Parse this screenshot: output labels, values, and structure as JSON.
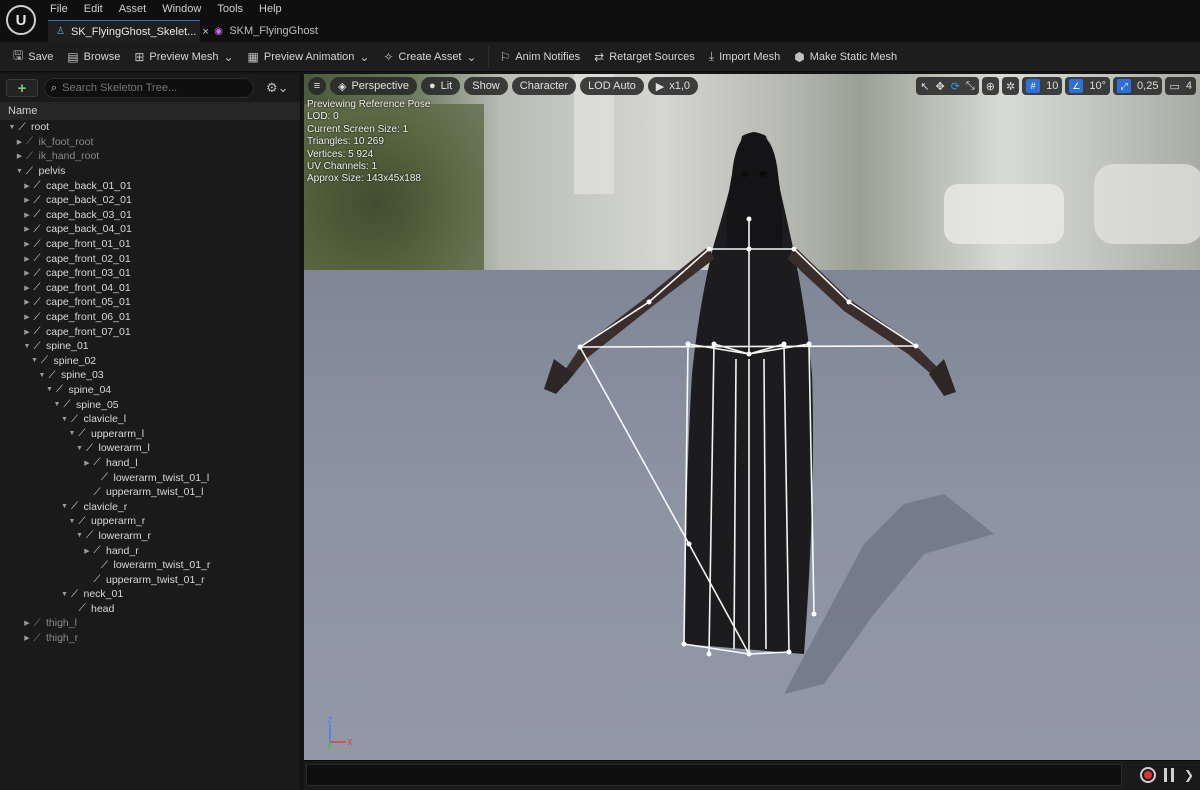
{
  "menu": [
    "File",
    "Edit",
    "Asset",
    "Window",
    "Tools",
    "Help"
  ],
  "tabs": [
    {
      "label": "SK_FlyingGhost_Skelet...",
      "close": "×"
    },
    {
      "label": "SKM_FlyingGhost"
    }
  ],
  "toolbar": {
    "save": "Save",
    "browse": "Browse",
    "preview_mesh": "Preview Mesh",
    "preview_animation": "Preview Animation",
    "create_asset": "Create Asset",
    "anim_notifies": "Anim Notifies",
    "retarget_sources": "Retarget Sources",
    "import_mesh": "Import Mesh",
    "make_static_mesh": "Make Static Mesh"
  },
  "skeleton_tree": {
    "search_placeholder": "Search Skeleton Tree...",
    "column_name": "Name",
    "bones": [
      {
        "name": "root",
        "depth": 0,
        "arrow": "open",
        "dim": false
      },
      {
        "name": "ik_foot_root",
        "depth": 1,
        "arrow": "closed",
        "dim": true
      },
      {
        "name": "ik_hand_root",
        "depth": 1,
        "arrow": "closed",
        "dim": true
      },
      {
        "name": "pelvis",
        "depth": 1,
        "arrow": "open",
        "dim": false
      },
      {
        "name": "cape_back_01_01",
        "depth": 2,
        "arrow": "closed",
        "dim": false
      },
      {
        "name": "cape_back_02_01",
        "depth": 2,
        "arrow": "closed",
        "dim": false
      },
      {
        "name": "cape_back_03_01",
        "depth": 2,
        "arrow": "closed",
        "dim": false
      },
      {
        "name": "cape_back_04_01",
        "depth": 2,
        "arrow": "closed",
        "dim": false
      },
      {
        "name": "cape_front_01_01",
        "depth": 2,
        "arrow": "closed",
        "dim": false
      },
      {
        "name": "cape_front_02_01",
        "depth": 2,
        "arrow": "closed",
        "dim": false
      },
      {
        "name": "cape_front_03_01",
        "depth": 2,
        "arrow": "closed",
        "dim": false
      },
      {
        "name": "cape_front_04_01",
        "depth": 2,
        "arrow": "closed",
        "dim": false
      },
      {
        "name": "cape_front_05_01",
        "depth": 2,
        "arrow": "closed",
        "dim": false
      },
      {
        "name": "cape_front_06_01",
        "depth": 2,
        "arrow": "closed",
        "dim": false
      },
      {
        "name": "cape_front_07_01",
        "depth": 2,
        "arrow": "closed",
        "dim": false
      },
      {
        "name": "spine_01",
        "depth": 2,
        "arrow": "open",
        "dim": false
      },
      {
        "name": "spine_02",
        "depth": 3,
        "arrow": "open",
        "dim": false
      },
      {
        "name": "spine_03",
        "depth": 4,
        "arrow": "open",
        "dim": false
      },
      {
        "name": "spine_04",
        "depth": 5,
        "arrow": "open",
        "dim": false
      },
      {
        "name": "spine_05",
        "depth": 6,
        "arrow": "open",
        "dim": false
      },
      {
        "name": "clavicle_l",
        "depth": 7,
        "arrow": "open",
        "dim": false
      },
      {
        "name": "upperarm_l",
        "depth": 8,
        "arrow": "open",
        "dim": false
      },
      {
        "name": "lowerarm_l",
        "depth": 9,
        "arrow": "open",
        "dim": false
      },
      {
        "name": "hand_l",
        "depth": 10,
        "arrow": "closed",
        "dim": false
      },
      {
        "name": "lowerarm_twist_01_l",
        "depth": 11,
        "arrow": "none",
        "dim": false
      },
      {
        "name": "upperarm_twist_01_l",
        "depth": 10,
        "arrow": "none",
        "dim": false
      },
      {
        "name": "clavicle_r",
        "depth": 7,
        "arrow": "open",
        "dim": false
      },
      {
        "name": "upperarm_r",
        "depth": 8,
        "arrow": "open",
        "dim": false
      },
      {
        "name": "lowerarm_r",
        "depth": 9,
        "arrow": "open",
        "dim": false
      },
      {
        "name": "hand_r",
        "depth": 10,
        "arrow": "closed",
        "dim": false
      },
      {
        "name": "lowerarm_twist_01_r",
        "depth": 11,
        "arrow": "none",
        "dim": false
      },
      {
        "name": "upperarm_twist_01_r",
        "depth": 10,
        "arrow": "none",
        "dim": false
      },
      {
        "name": "neck_01",
        "depth": 7,
        "arrow": "open",
        "dim": false
      },
      {
        "name": "head",
        "depth": 8,
        "arrow": "none",
        "dim": false
      },
      {
        "name": "thigh_l",
        "depth": 2,
        "arrow": "closed",
        "dim": true
      },
      {
        "name": "thigh_r",
        "depth": 2,
        "arrow": "closed",
        "dim": true
      }
    ]
  },
  "viewport": {
    "view_mode": "Perspective",
    "lighting": "Lit",
    "show": "Show",
    "character": "Character",
    "lod": "LOD Auto",
    "play_speed": "x1,0",
    "grid_snap": "10",
    "rotation_snap": "10°",
    "scale_snap": "0,25",
    "camera_speed": "4",
    "info_lines": [
      "Previewing Reference Pose",
      "LOD: 0",
      "Current Screen Size: 1",
      "Triangles: 10 269",
      "Vertices: 5 924",
      "UV Channels: 1",
      "Approx Size: 143x45x188"
    ]
  },
  "colors": {
    "accent": "#2f6fd8",
    "record": "#e03030",
    "add": "#6fd06f"
  }
}
